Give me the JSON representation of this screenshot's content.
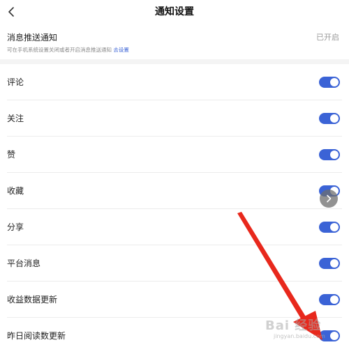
{
  "header": {
    "title": "通知设置",
    "back_icon": "chevron-left-icon"
  },
  "push": {
    "title": "消息推送通知",
    "description": "可在手机系统设置关闭或者开启消息推送通知",
    "link_label": "去设置",
    "status": "已开启"
  },
  "settings": [
    {
      "label": "评论",
      "enabled": true
    },
    {
      "label": "关注",
      "enabled": true
    },
    {
      "label": "赞",
      "enabled": true
    },
    {
      "label": "收藏",
      "enabled": true
    },
    {
      "label": "分享",
      "enabled": true
    },
    {
      "label": "平台消息",
      "enabled": true
    },
    {
      "label": "收益数据更新",
      "enabled": true
    },
    {
      "label": "昨日阅读数更新",
      "enabled": true
    }
  ],
  "colors": {
    "accent": "#3b63d6",
    "annotation_arrow": "#e8281c"
  },
  "floating_button_icon": "chevron-right-icon",
  "watermark": {
    "text": "Bai 经验",
    "subtext": "jingyan.baidu.com"
  }
}
